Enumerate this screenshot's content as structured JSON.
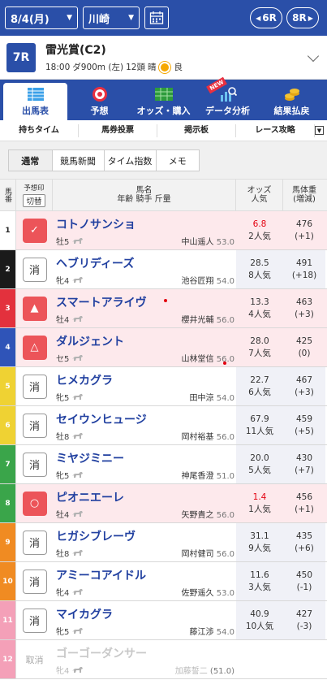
{
  "topbar": {
    "date": "8/4(月)",
    "venue": "川崎",
    "prev_race": "6R",
    "next_race": "8R"
  },
  "race": {
    "number": "7R",
    "name": "雷光賞(C2)",
    "time": "18:00",
    "course": "ダ900m (左)",
    "runners": "12頭",
    "weather": "晴",
    "track": "良"
  },
  "menu": [
    {
      "label": "出馬表",
      "icon": "table-icon",
      "active": true
    },
    {
      "label": "予想",
      "icon": "target-icon",
      "active": false
    },
    {
      "label": "オッズ・購入",
      "icon": "bet-icon",
      "active": false
    },
    {
      "label": "データ分析",
      "icon": "chart-icon",
      "active": false,
      "badge": "NEW"
    },
    {
      "label": "結果払戻",
      "icon": "coins-icon",
      "active": false
    }
  ],
  "submenu": [
    "持ちタイム",
    "馬券投票",
    "掲示板",
    "レース攻略"
  ],
  "view_tabs": [
    "通常",
    "競馬新聞",
    "タイム指数",
    "メモ"
  ],
  "table_header": {
    "no": "馬番",
    "mark_label": "予想印",
    "mark_button": "切替",
    "horse_line1": "馬名",
    "horse_line2": "年齢 騎手 斤量",
    "odds_line1": "オッズ",
    "odds_line2": "人気",
    "weight_line1": "馬体重",
    "weight_line2": "(増減)"
  },
  "colors": {
    "brand": "#2a4fa8",
    "horse_name": "#2140a0",
    "highlight_row": "#fde9ec",
    "mark_red": "#ec5459"
  },
  "horses": [
    {
      "no": "1",
      "mark": "✓",
      "name": "コトノサンショ",
      "sex_age": "牡5",
      "jockey": "中山遥人",
      "kg": "53.0",
      "odds": "6.8",
      "pop": "2人気",
      "weight": "476",
      "diff": "(+1)",
      "hot": true
    },
    {
      "no": "2",
      "mark": "消",
      "name": "ヘブリディーズ",
      "sex_age": "牝4",
      "jockey": "池谷匠翔",
      "kg": "54.0",
      "odds": "28.5",
      "pop": "8人気",
      "weight": "491",
      "diff": "(+18)",
      "hot": false
    },
    {
      "no": "3",
      "mark": "▲",
      "name": "スマートアライヴ",
      "sex_age": "牡4",
      "jockey": "櫻井光輔",
      "kg": "56.0",
      "odds": "13.3",
      "pop": "4人気",
      "weight": "463",
      "diff": "(+3)",
      "hot": false
    },
    {
      "no": "4",
      "mark": "△",
      "name": "ダルジェント",
      "sex_age": "セ5",
      "jockey": "山林堂信",
      "kg": "56.0",
      "odds": "28.0",
      "pop": "7人気",
      "weight": "425",
      "diff": "(0)",
      "hot": false
    },
    {
      "no": "5",
      "mark": "消",
      "name": "ヒメカグラ",
      "sex_age": "牝5",
      "jockey": "田中涼",
      "kg": "54.0",
      "odds": "22.7",
      "pop": "6人気",
      "weight": "467",
      "diff": "(+3)",
      "hot": false
    },
    {
      "no": "6",
      "mark": "消",
      "name": "セイウンヒュージ",
      "sex_age": "牡8",
      "jockey": "岡村裕基",
      "kg": "56.0",
      "odds": "67.9",
      "pop": "11人気",
      "weight": "459",
      "diff": "(+5)",
      "hot": false
    },
    {
      "no": "7",
      "mark": "消",
      "name": "ミヤジミニー",
      "sex_age": "牝5",
      "jockey": "神尾香澄",
      "kg": "51.0",
      "odds": "20.0",
      "pop": "5人気",
      "weight": "430",
      "diff": "(+7)",
      "hot": false
    },
    {
      "no": "8",
      "mark": "○",
      "name": "ピオニエーレ",
      "sex_age": "牡4",
      "jockey": "矢野貴之",
      "kg": "56.0",
      "odds": "1.4",
      "pop": "1人気",
      "weight": "456",
      "diff": "(+1)",
      "hot": true
    },
    {
      "no": "9",
      "mark": "消",
      "name": "ヒガシブレーヴ",
      "sex_age": "牡8",
      "jockey": "岡村健司",
      "kg": "56.0",
      "odds": "31.1",
      "pop": "9人気",
      "weight": "435",
      "diff": "(+6)",
      "hot": false
    },
    {
      "no": "10",
      "mark": "消",
      "name": "アミーコアイドル",
      "sex_age": "牝4",
      "jockey": "佐野遥久",
      "kg": "53.0",
      "odds": "11.6",
      "pop": "3人気",
      "weight": "450",
      "diff": "(-1)",
      "hot": false
    },
    {
      "no": "11",
      "mark": "消",
      "name": "マイカグラ",
      "sex_age": "牝5",
      "jockey": "藤江渉",
      "kg": "54.0",
      "odds": "40.9",
      "pop": "10人気",
      "weight": "427",
      "diff": "(-3)",
      "hot": false
    },
    {
      "no": "12",
      "mark": "取消",
      "name": "ゴーゴーダンサー",
      "sex_age": "牝4",
      "jockey": "加藤誓二",
      "kg": "(51.0)",
      "odds": "",
      "pop": "",
      "weight": "",
      "diff": "",
      "hot": false
    }
  ]
}
